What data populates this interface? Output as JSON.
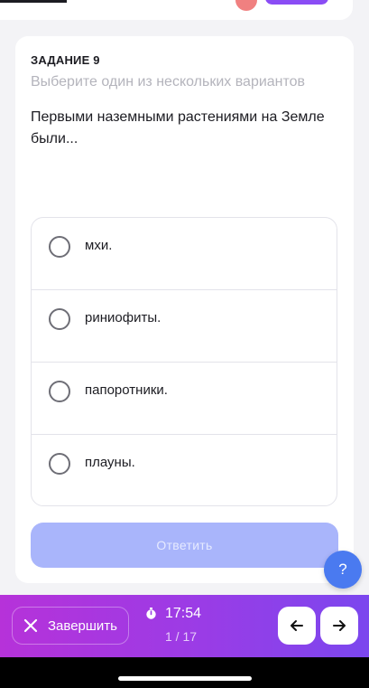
{
  "task": {
    "label": "ЗАДАНИЕ 9",
    "hint": "Выберите один из нескольких вариантов",
    "question": "Первыми наземными растениями на Земле были..."
  },
  "options": [
    {
      "label": "мхи."
    },
    {
      "label": "риниофиты."
    },
    {
      "label": "папоротники."
    },
    {
      "label": "плауны."
    }
  ],
  "submit": {
    "label": "Ответить"
  },
  "help": {
    "label": "?"
  },
  "bottom_bar": {
    "finish_label": "Завершить",
    "timer": "17:54",
    "progress": "1 / 17"
  },
  "colors": {
    "submit_disabled": "#a9b5fb",
    "help_fab": "#4a7af0",
    "bar_start": "#b632d9",
    "bar_end": "#7b47ee"
  },
  "icons": {
    "finish": "close-icon",
    "timer": "stopwatch-icon",
    "prev": "arrow-left-icon",
    "next": "arrow-right-icon"
  }
}
